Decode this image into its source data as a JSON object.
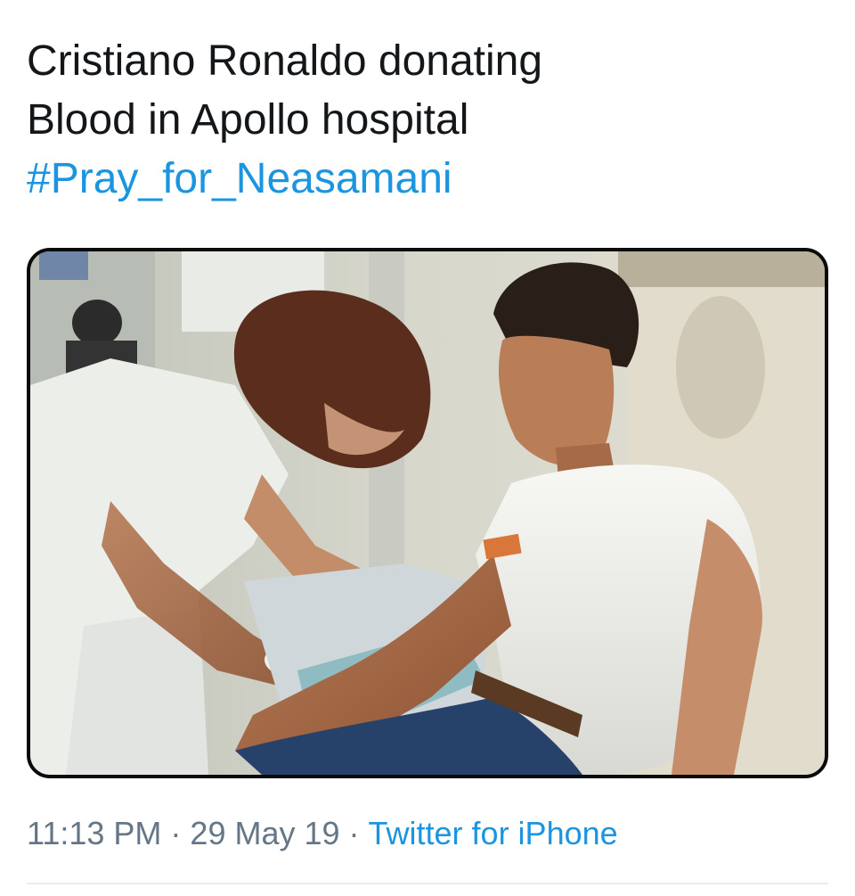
{
  "tweet": {
    "text_line_1": "Cristiano Ronaldo donating",
    "text_line_2": "Blood in Apollo hospital",
    "hashtag": "#Pray_for_Neasamani"
  },
  "media": {
    "alt": "photo of a nurse drawing blood from a man in a white t-shirt"
  },
  "meta": {
    "time": "11:13 PM",
    "separator": "·",
    "date": "29 May 19",
    "source": "Twitter for iPhone"
  },
  "colors": {
    "text": "#14171a",
    "link": "#1b95e0",
    "meta": "#657786",
    "divider": "#e6ecf0"
  }
}
